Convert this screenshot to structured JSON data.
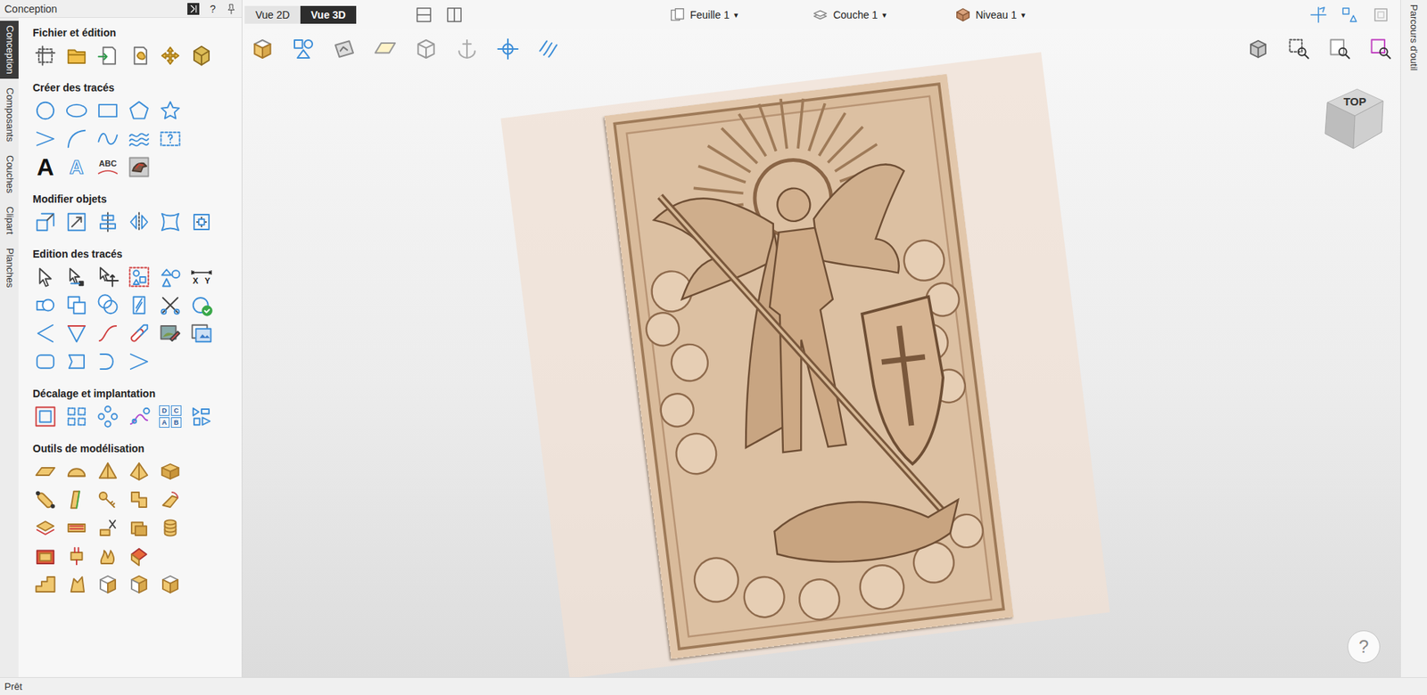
{
  "panel": {
    "title": "Conception",
    "help": "?"
  },
  "side_tabs": [
    {
      "label": "Conception",
      "selected": true
    },
    {
      "label": "Composants",
      "selected": false
    },
    {
      "label": "Couches",
      "selected": false
    },
    {
      "label": "Clipart",
      "selected": false
    },
    {
      "label": "Planches",
      "selected": false
    }
  ],
  "sections": [
    {
      "title": "Fichier et édition",
      "glyphs": []
    },
    {
      "title": "Créer des tracés",
      "glyphs": [
        "A",
        "A",
        "ABC"
      ]
    },
    {
      "title": "Modifier objets",
      "glyphs": []
    },
    {
      "title": "Edition des tracés",
      "glyphs": [
        "X",
        "Y"
      ]
    },
    {
      "title": "Décalage et implantation",
      "glyphs": [
        "D",
        "C",
        "A",
        "B"
      ]
    },
    {
      "title": "Outils de modélisation",
      "glyphs": []
    }
  ],
  "view_tabs": [
    {
      "label": "Vue 2D",
      "selected": false
    },
    {
      "label": "Vue 3D",
      "selected": true
    }
  ],
  "dropdowns": [
    {
      "label": "Feuille 1",
      "caret": "▾"
    },
    {
      "label": "Couche 1",
      "caret": "▾"
    },
    {
      "label": "Niveau 1",
      "caret": "▾"
    }
  ],
  "view_cube": {
    "label": "TOP"
  },
  "help_button": "?",
  "right_tab": "Parcours d'outil",
  "status": "Prêt"
}
